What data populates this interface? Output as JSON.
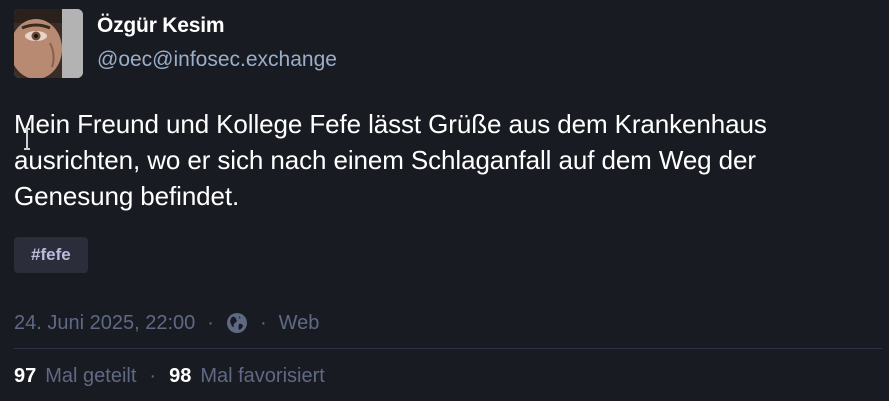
{
  "author": {
    "display_name": "Özgür Kesim",
    "handle": "@oec@infosec.exchange"
  },
  "post": {
    "content": "Mein Freund und Kollege Fefe lässt Grüße aus dem Krankenhaus ausrichten, wo er sich nach einem Schlaganfall auf dem Weg der Genesung befindet.",
    "hashtag": "#fefe",
    "timestamp": "24. Juni 2025, 22:00",
    "meta_separator": "·",
    "visibility_icon": "globe-icon",
    "application": "Web"
  },
  "stats": {
    "reblogs_count": "97",
    "reblogs_label": "Mal geteilt",
    "separator": "·",
    "favourites_count": "98",
    "favourites_label": "Mal favorisiert"
  },
  "colors": {
    "background": "#191b22",
    "secondary_text": "#9baec8",
    "muted_text": "#606984",
    "hashtag_bg": "#2c2d3a",
    "hashtag_text": "#b9bdd9"
  }
}
